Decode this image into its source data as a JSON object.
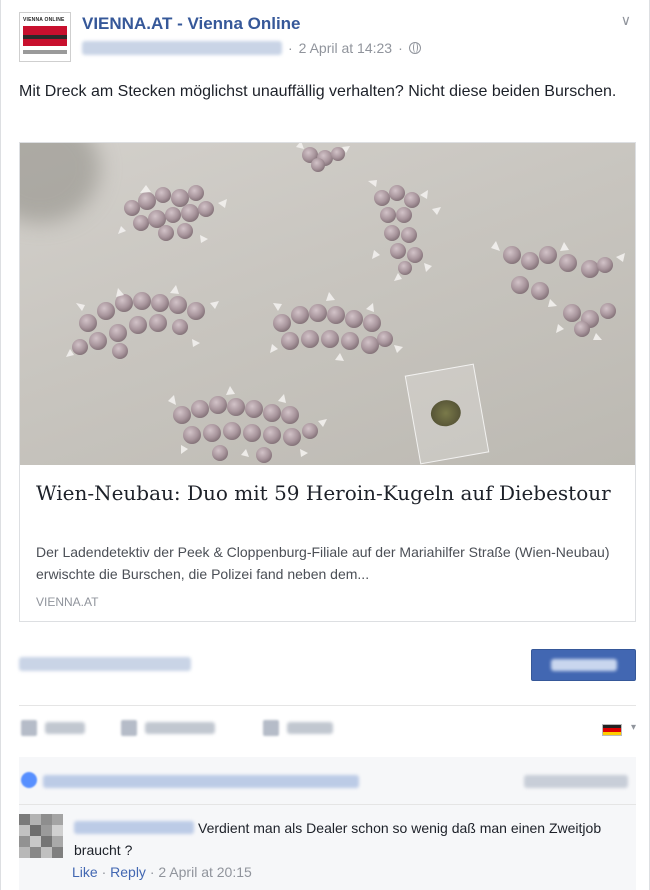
{
  "header": {
    "page_name": "VIENNA.AT - Vienna Online",
    "logo_text": "VIENNA ONLINE",
    "timestamp": "2 April at 14:23",
    "separator": "·",
    "privacy_icon": "globe-icon",
    "menu_icon": "chevron-down-icon"
  },
  "post": {
    "text": "Mit Dreck am Stecken möglichst unauffällig verhalten? Nicht diese beiden Burschen."
  },
  "article": {
    "title": "Wien-Neubau: Duo mit 59 Heroin-Kugeln auf Diebestour",
    "description": "Der Ladendetektiv der Peek & Cloppenburg-Filiale auf der Mariahilfer Straße (Wien-Neubau) erwischte die Burschen, die Polizei fand neben dem...",
    "source": "VIENNA.AT"
  },
  "actions": {
    "like_icon": "thumbs-up-icon",
    "comment_icon": "comment-icon",
    "share_icon": "share-icon",
    "flag_icon": "germany-flag-icon"
  },
  "colors": {
    "link_blue": "#365899",
    "boost_blue": "#4267b2",
    "meta_gray": "#90949c",
    "text": "#1d2129"
  },
  "comment": {
    "text": "Verdient man als Dealer schon so wenig daß man einen Zweitjob braucht ?",
    "like_label": "Like",
    "reply_label": "Reply",
    "separator": "·",
    "timestamp": "2 April at 20:15"
  }
}
